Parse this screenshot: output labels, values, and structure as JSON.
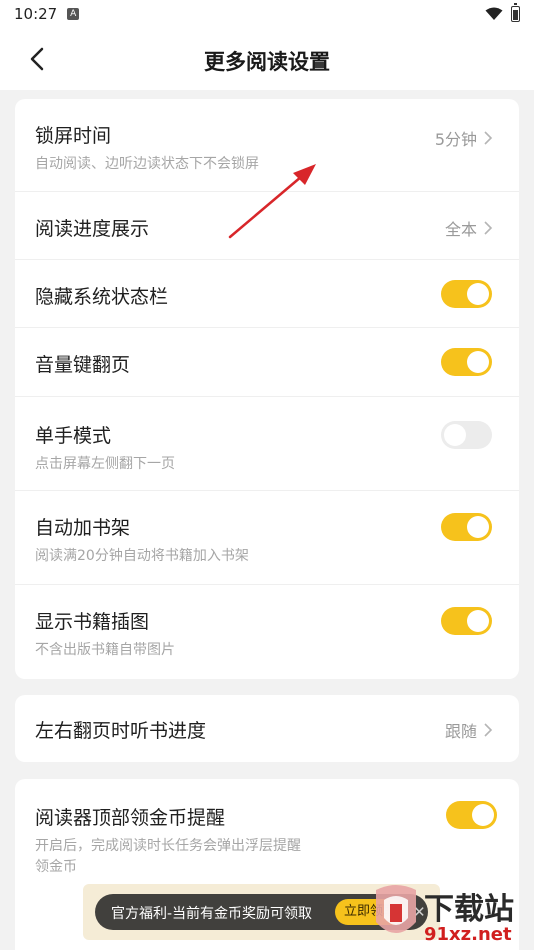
{
  "status_bar": {
    "time": "10:27",
    "badge": "A"
  },
  "header": {
    "title": "更多阅读设置"
  },
  "group1": {
    "lock_screen": {
      "label": "锁屏时间",
      "sub": "自动阅读、边听边读状态下不会锁屏",
      "value": "5分钟"
    },
    "progress": {
      "label": "阅读进度展示",
      "value": "全本"
    },
    "hide_status": {
      "label": "隐藏系统状态栏",
      "on": true
    },
    "volume_keys": {
      "label": "音量键翻页",
      "on": true
    },
    "one_hand": {
      "label": "单手模式",
      "sub": "点击屏幕左侧翻下一页",
      "on": false
    },
    "auto_shelf": {
      "label": "自动加书架",
      "sub": "阅读满20分钟自动将书籍加入书架",
      "on": true
    },
    "illustrations": {
      "label": "显示书籍插图",
      "sub": "不含出版书籍自带图片",
      "on": true
    }
  },
  "group2": {
    "tts_progress": {
      "label": "左右翻页时听书进度",
      "value": "跟随"
    }
  },
  "group3": {
    "coin_reminder": {
      "label": "阅读器顶部领金币提醒",
      "sub_line1": "开启后，完成阅读时长任务会弹出浮层提醒",
      "sub_line2": "领金币",
      "on": true
    }
  },
  "banner": {
    "text": "官方福利-当前有金币奖励可领取",
    "button": "立即领取",
    "close": "✕"
  },
  "watermark": {
    "title": "下载站",
    "sub": "91xz.net"
  },
  "colors": {
    "accent": "#f6c21c",
    "annotation": "#d8262a"
  }
}
